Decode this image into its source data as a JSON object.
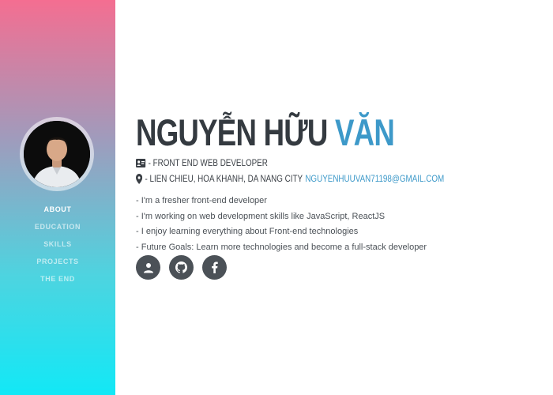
{
  "sidebar": {
    "avatar": "profile-photo",
    "nav_items": [
      {
        "label": "ABOUT",
        "active": true
      },
      {
        "label": "EDUCATION",
        "active": false
      },
      {
        "label": "SKILLS",
        "active": false
      },
      {
        "label": "PROJECTS",
        "active": false
      },
      {
        "label": "THE END",
        "active": false
      }
    ],
    "gradient_colors": [
      "#f46e91",
      "#12e8f6"
    ]
  },
  "main": {
    "name_first": "NGUYỄN HỮU",
    "name_accent": "VĂN",
    "role_icon": "id-card-icon",
    "role": "- FRONT END WEB DEVELOPER",
    "location_icon": "map-marker-icon",
    "location": "- LIEN CHIEU, HOA KHANH, DA NANG CITY",
    "email": "NGUYENHUUVAN71198@GMAIL.COM",
    "bio": [
      "- I'm a fresher front-end developer",
      "- I'm working on web development skills like JavaScript, ReactJS",
      "- I enjoy learning everything about Front-end technologies",
      "- Future Goals: Learn more technologies and become a full-stack developer"
    ],
    "social": [
      {
        "icon": "user-icon"
      },
      {
        "icon": "github-icon"
      },
      {
        "icon": "facebook-icon"
      }
    ],
    "accent_color": "#3d99c9",
    "text_color": "#343a40"
  }
}
